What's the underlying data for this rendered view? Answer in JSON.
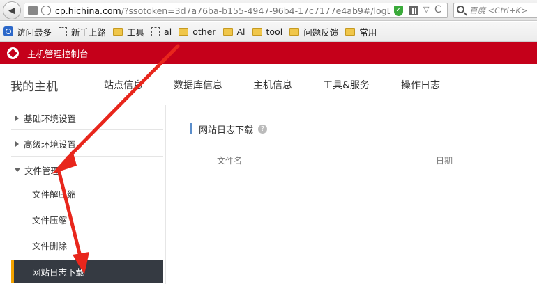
{
  "browser": {
    "url_host": "cp.hichina.com",
    "url_rest": "/?ssotoken=3d7a76ba-b155-4947-96b4-17c7177e4ab9#/logDowr",
    "search_placeholder": "百度 <Ctrl+K>"
  },
  "bookmarks": [
    {
      "label": "访问最多",
      "icon": "visit-icon"
    },
    {
      "label": "新手上路",
      "icon": "page-dash-icon"
    },
    {
      "label": "工具",
      "icon": "folder-icon"
    },
    {
      "label": "al",
      "icon": "page-dash-icon"
    },
    {
      "label": "other",
      "icon": "folder-icon"
    },
    {
      "label": "Al",
      "icon": "folder-icon"
    },
    {
      "label": "tool",
      "icon": "folder-icon"
    },
    {
      "label": "问题反馈",
      "icon": "folder-icon"
    },
    {
      "label": "常用",
      "icon": "folder-icon"
    }
  ],
  "app": {
    "title": "主机管理控制台",
    "brand_color": "#c5001a"
  },
  "topnav": {
    "title": "我的主机",
    "tabs": [
      "站点信息",
      "数据库信息",
      "主机信息",
      "工具&服务",
      "操作日志"
    ]
  },
  "sidebar": {
    "groups": [
      "基础环境设置",
      "高级环境设置",
      "文件管理"
    ],
    "sub_items": [
      "文件解压缩",
      "文件压缩",
      "文件删除",
      "网站日志下载"
    ],
    "active_item": "网站日志下载",
    "active_accent": "#f4a300"
  },
  "content": {
    "title": "网站日志下载",
    "columns": [
      "文件名",
      "日期"
    ]
  },
  "annotation_color": "#e8261c"
}
